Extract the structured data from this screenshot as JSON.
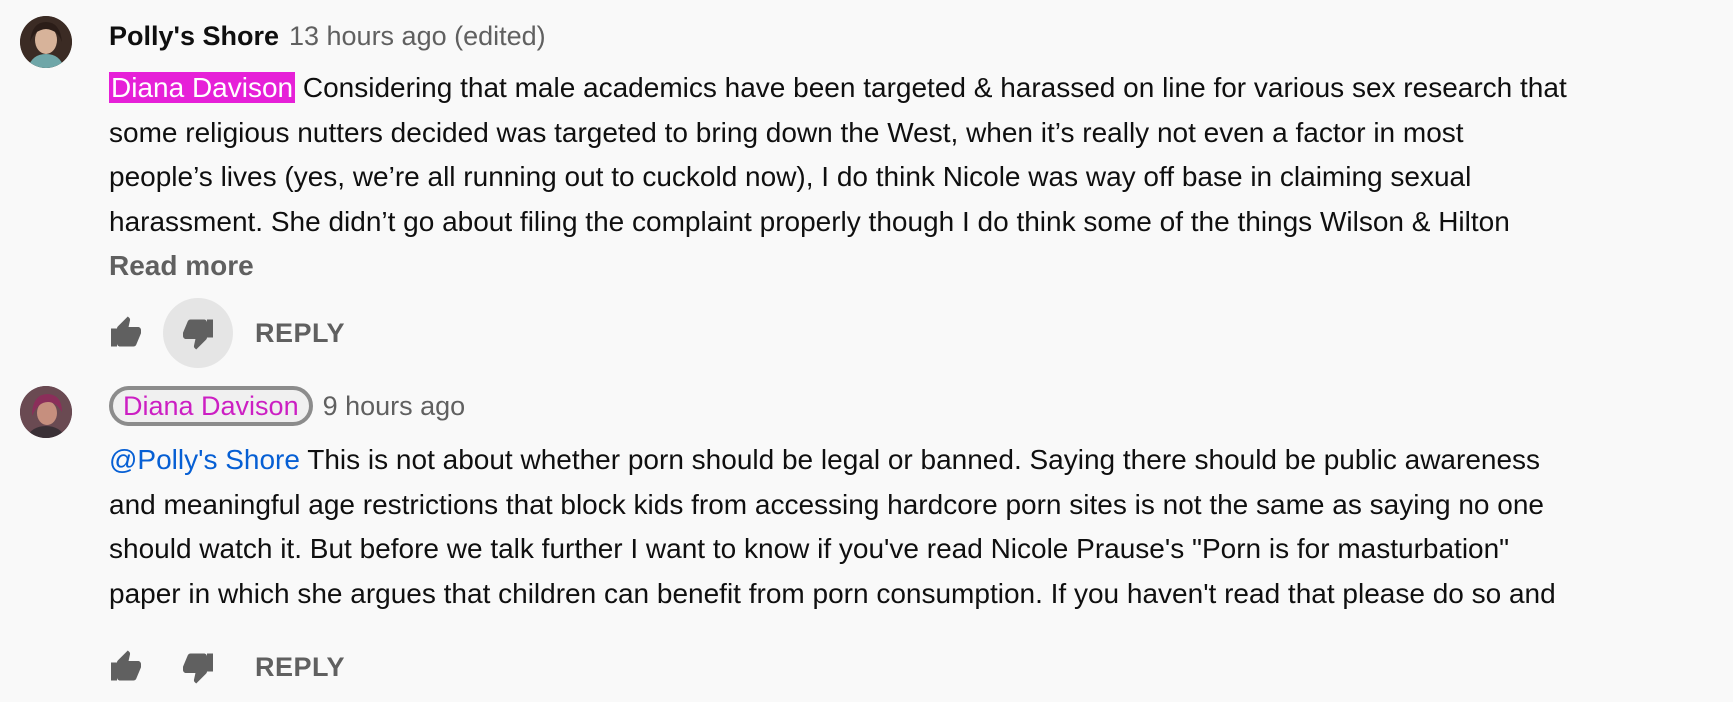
{
  "comments": [
    {
      "author": "Polly's Shore",
      "time": "13 hours ago (edited)",
      "mention": "Diana Davison",
      "lines": [
        " Considering that male academics have been targeted & harassed on line for various sex research that",
        "some religious nutters decided was targeted to bring down the West, when it’s really not even a factor in most",
        "people’s lives (yes, we’re all running out to cuckold now), I do think Nicole was way off base in claiming sexual",
        "harassment. She didn’t go about filing the complaint properly though I do think some of the things Wilson & Hilton"
      ],
      "read_more": "Read more",
      "reply": "REPLY"
    },
    {
      "author": "Diana Davison",
      "time": "9 hours ago",
      "mention": "@Polly's Shore",
      "lines": [
        " This is not about whether porn should be legal or banned. Saying there should be public awareness",
        "and meaningful age restrictions that block kids from accessing hardcore porn sites is not the same as saying no one",
        "should watch it. But before we talk further I want to know if you've read Nicole Prause's \"Porn is for masturbation\"",
        "paper in which she argues that children can benefit from porn consumption. If you haven't read that please do so and"
      ],
      "reply": "REPLY"
    }
  ],
  "icons": {
    "like": "thumb-up-icon",
    "dislike": "thumb-down-icon"
  },
  "colors": {
    "mention_highlight": "#e620d8",
    "link": "#065fd4",
    "author_chip_text": "#cc1fc3"
  }
}
